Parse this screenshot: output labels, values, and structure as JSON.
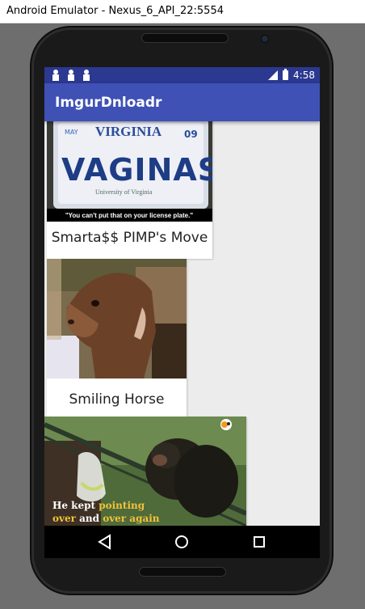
{
  "window": {
    "title": "Android Emulator - Nexus_6_API_22:5554"
  },
  "statusbar": {
    "time": "4:58",
    "signal_label": "4G"
  },
  "appbar": {
    "title": "ImgurDnloadr"
  },
  "cards": [
    {
      "caption": "Smarta$$ PIMP's Move",
      "image_text": "\"You can't put that on your license plate.\"",
      "plate_text": "VAGINAS",
      "plate_state": "VIRGINIA",
      "plate_month": "MAY",
      "plate_year": "09",
      "plate_sub": "University of Virginia"
    },
    {
      "caption": "Smiling Horse"
    },
    {
      "caption": "",
      "image_text_1": "He kept ",
      "image_text_hl1": "pointing",
      "image_text_2": "over",
      "image_text_3": " and ",
      "image_text_hl2": "over again"
    }
  ],
  "colors": {
    "statusbar": "#2b3990",
    "appbar": "#3f51b5",
    "background": "#ececec"
  },
  "icons": {
    "back": "back-triangle-icon",
    "home": "home-circle-icon",
    "recents": "recents-square-icon"
  }
}
